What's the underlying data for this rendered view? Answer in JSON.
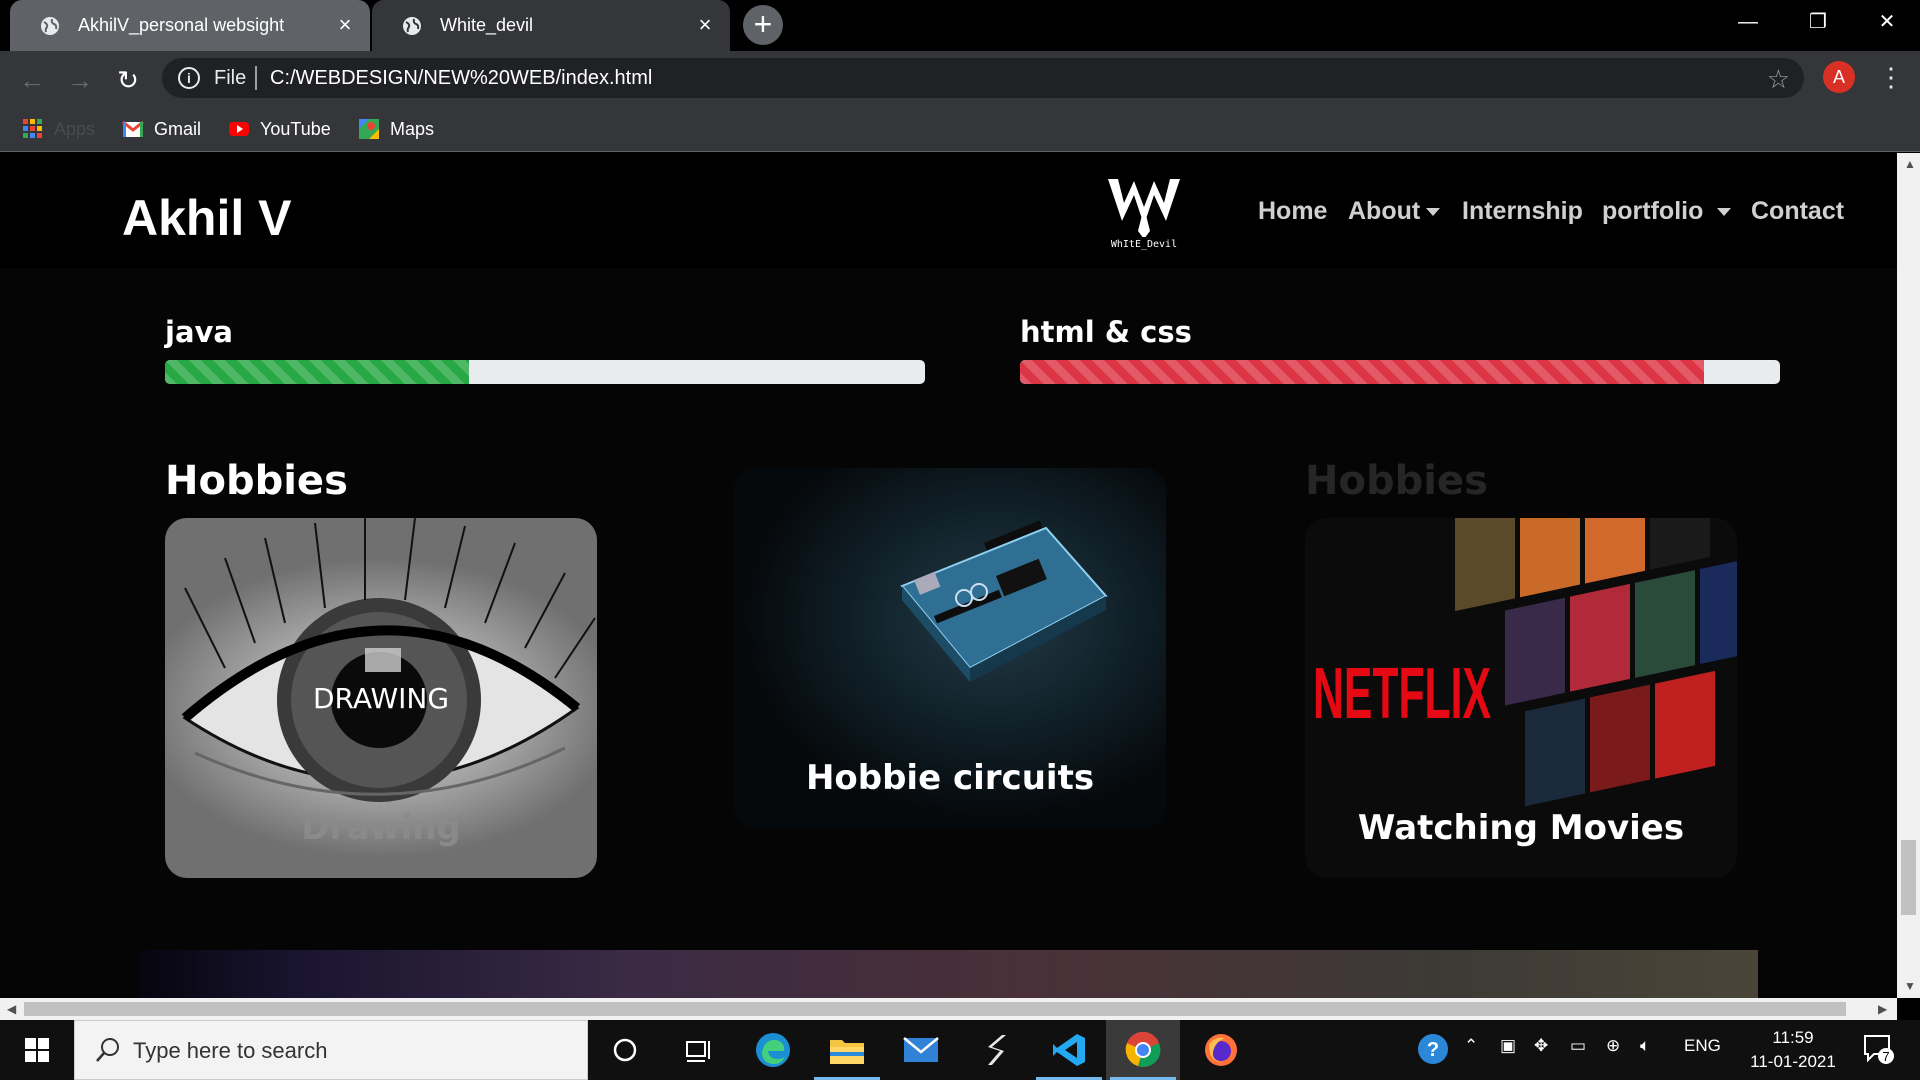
{
  "browser": {
    "tabs": [
      {
        "title": "AkhilV_personal websight",
        "active": false
      },
      {
        "title": "White_devil",
        "active": true
      }
    ],
    "address": {
      "scheme": "File",
      "url": "C:/WEBDESIGN/NEW%20WEB/index.html"
    },
    "profile_initial": "A",
    "bookmarks": [
      {
        "label": "Apps",
        "icon": "apps-grid-icon"
      },
      {
        "label": "Gmail",
        "icon": "gmail-icon"
      },
      {
        "label": "YouTube",
        "icon": "youtube-icon"
      },
      {
        "label": "Maps",
        "icon": "maps-icon"
      }
    ]
  },
  "site": {
    "brand": "Akhil V",
    "logo_text": "WhItE_Devil",
    "nav": {
      "home": "Home",
      "about": "About",
      "internship": "Internship",
      "portfolio": "portfolio",
      "contact": "Contact"
    },
    "skills": [
      {
        "label": "java",
        "percent": 40,
        "color": "#28a745"
      },
      {
        "label": "html & css",
        "percent": 90,
        "color": "#dc3545"
      }
    ],
    "hobbies": {
      "title": "Hobbies",
      "title_faded": "Hobbies",
      "cards": [
        {
          "overlay": "DRAWING",
          "caption": "Drawing"
        },
        {
          "caption": "Hobbie circuits"
        },
        {
          "brand": "NETFLIX",
          "caption": "Watching Movies"
        }
      ]
    }
  },
  "taskbar": {
    "search_placeholder": "Type here to search",
    "language": "ENG",
    "time": "11:59",
    "date": "11-01-2021",
    "notification_count": "7"
  }
}
